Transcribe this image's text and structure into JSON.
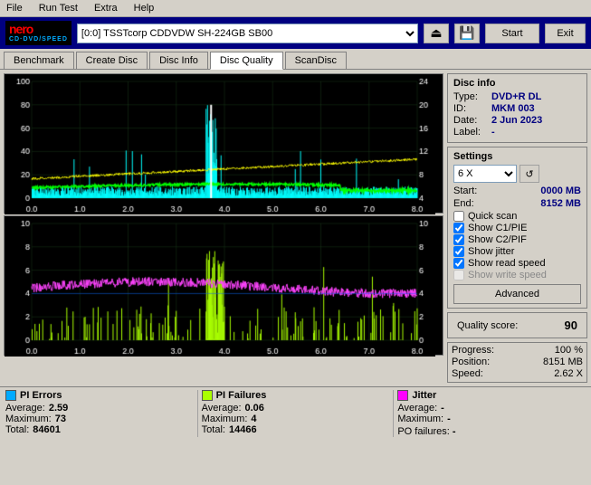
{
  "window": {
    "title": "Nero CD-DVD Speed"
  },
  "menubar": {
    "items": [
      "File",
      "Run Test",
      "Extra",
      "Help"
    ]
  },
  "header": {
    "drive_selector": "[0:0]  TSSTcorp CDDVDW SH-224GB SB00",
    "start_label": "Start",
    "exit_label": "Exit"
  },
  "tabs": [
    {
      "label": "Benchmark",
      "active": false
    },
    {
      "label": "Create Disc",
      "active": false
    },
    {
      "label": "Disc Info",
      "active": false
    },
    {
      "label": "Disc Quality",
      "active": true
    },
    {
      "label": "ScanDisc",
      "active": false
    }
  ],
  "disc_info": {
    "title": "Disc info",
    "type_label": "Type:",
    "type_value": "DVD+R DL",
    "id_label": "ID:",
    "id_value": "MKM 003",
    "date_label": "Date:",
    "date_value": "2 Jun 2023",
    "label_label": "Label:",
    "label_value": "-"
  },
  "settings": {
    "title": "Settings",
    "speed": "6 X",
    "start_label": "Start:",
    "start_value": "0000 MB",
    "end_label": "End:",
    "end_value": "8152 MB",
    "quick_scan": {
      "label": "Quick scan",
      "checked": false
    },
    "show_c1pie": {
      "label": "Show C1/PIE",
      "checked": true
    },
    "show_c2pif": {
      "label": "Show C2/PIF",
      "checked": true
    },
    "show_jitter": {
      "label": "Show jitter",
      "checked": true
    },
    "show_read_speed": {
      "label": "Show read speed",
      "checked": true
    },
    "show_write_speed": {
      "label": "Show write speed",
      "checked": false,
      "disabled": true
    },
    "advanced_label": "Advanced"
  },
  "quality_score": {
    "label": "Quality score:",
    "value": "90"
  },
  "progress": {
    "progress_label": "Progress:",
    "progress_value": "100 %",
    "position_label": "Position:",
    "position_value": "8151 MB",
    "speed_label": "Speed:",
    "speed_value": "2.62 X"
  },
  "stats": {
    "pi_errors": {
      "title": "PI Errors",
      "color": "#00aaff",
      "average_label": "Average:",
      "average_value": "2.59",
      "maximum_label": "Maximum:",
      "maximum_value": "73",
      "total_label": "Total:",
      "total_value": "84601"
    },
    "pi_failures": {
      "title": "PI Failures",
      "color": "#aaff00",
      "average_label": "Average:",
      "average_value": "0.06",
      "maximum_label": "Maximum:",
      "maximum_value": "4",
      "total_label": "Total:",
      "total_value": "14466"
    },
    "jitter": {
      "title": "Jitter",
      "color": "#ff00ff",
      "average_label": "Average:",
      "average_value": "-",
      "maximum_label": "Maximum:",
      "maximum_value": "-"
    },
    "po_failures": {
      "label": "PO failures:",
      "value": "-"
    }
  },
  "chart_top": {
    "y_left_max": 100,
    "y_right_max": 24,
    "x_labels": [
      "0.0",
      "1.0",
      "2.0",
      "3.0",
      "4.0",
      "5.0",
      "6.0",
      "7.0",
      "8.0"
    ]
  },
  "chart_bottom": {
    "y_left_max": 10,
    "y_right_max": 10,
    "x_labels": [
      "0.0",
      "1.0",
      "2.0",
      "3.0",
      "4.0",
      "5.0",
      "6.0",
      "7.0",
      "8.0"
    ]
  }
}
